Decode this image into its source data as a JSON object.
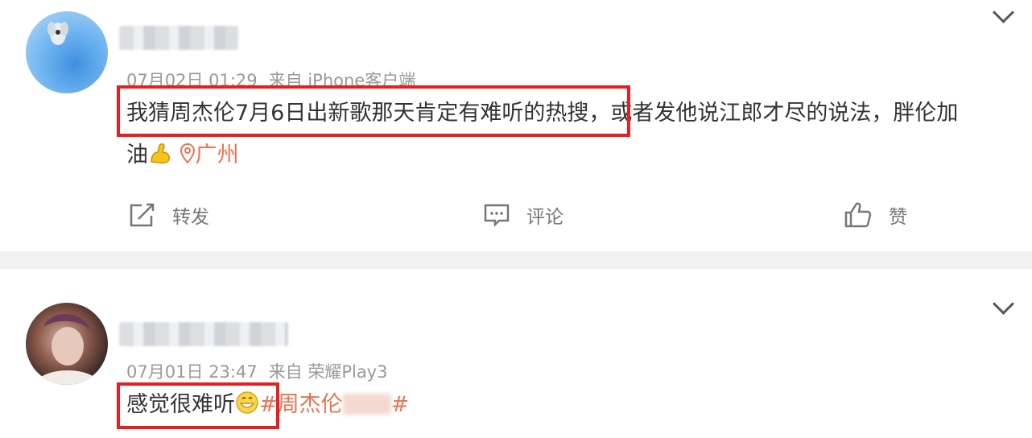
{
  "posts": [
    {
      "date": "07月02日 01:29",
      "source": "来自 iPhone客户端",
      "text_highlighted": "我猜周杰伦7月6日出新歌那天肯定有难听的热搜",
      "text_rest": "或者发他说江郎才尽的说法，胖伦加",
      "text_line2": "油",
      "location": "广州",
      "actions": {
        "forward": "转发",
        "comment": "评论",
        "like": "赞"
      }
    },
    {
      "date": "07月01日 23:47",
      "source": "来自 荣耀Play3",
      "text_highlighted": "感觉很难听",
      "topic_start": "#周杰伦",
      "topic_end": "#"
    }
  ],
  "colors": {
    "highlight": "#e62020",
    "topic": "#eb7350",
    "meta": "#999999"
  },
  "icons": [
    "chevron-down-icon",
    "share-icon",
    "comment-icon",
    "thumbs-up-icon",
    "location-pin-icon",
    "flex-arm-emoji",
    "grin-emoji"
  ]
}
